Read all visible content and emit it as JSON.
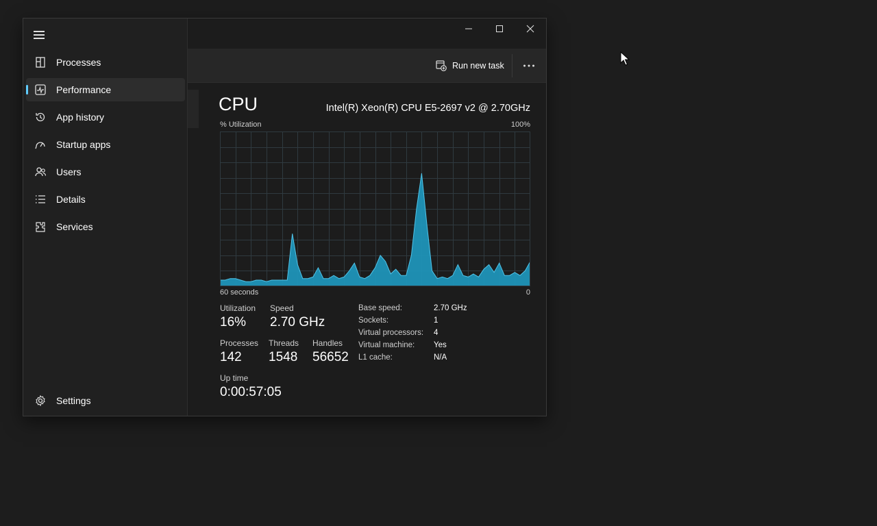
{
  "sidebar": {
    "items": [
      {
        "label": "Processes",
        "icon": "processes-icon"
      },
      {
        "label": "Performance",
        "icon": "performance-icon",
        "active": true
      },
      {
        "label": "App history",
        "icon": "app-history-icon"
      },
      {
        "label": "Startup apps",
        "icon": "startup-apps-icon"
      },
      {
        "label": "Users",
        "icon": "users-icon"
      },
      {
        "label": "Details",
        "icon": "details-icon"
      },
      {
        "label": "Services",
        "icon": "services-icon"
      }
    ],
    "settings_label": "Settings"
  },
  "commandbar": {
    "run_new_task": "Run new task"
  },
  "cpu": {
    "title": "CPU",
    "name": "Intel(R) Xeon(R) CPU E5-2697 v2 @ 2.70GHz",
    "utilization_axis_label": "% Utilization",
    "utilization_axis_max": "100%",
    "time_axis_left": "60 seconds",
    "time_axis_right": "0",
    "stats": {
      "utilization_label": "Utilization",
      "utilization_value": "16%",
      "speed_label": "Speed",
      "speed_value": "2.70 GHz",
      "processes_label": "Processes",
      "processes_value": "142",
      "threads_label": "Threads",
      "threads_value": "1548",
      "handles_label": "Handles",
      "handles_value": "56652",
      "uptime_label": "Up time",
      "uptime_value": "0:00:57:05"
    },
    "info": [
      {
        "label": "Base speed:",
        "value": "2.70 GHz"
      },
      {
        "label": "Sockets:",
        "value": "1"
      },
      {
        "label": "Virtual processors:",
        "value": "4"
      },
      {
        "label": "Virtual machine:",
        "value": "Yes"
      },
      {
        "label": "L1 cache:",
        "value": "N/A"
      }
    ]
  },
  "colors": {
    "accent": "#60cdff",
    "graph_fill": "#1f93b8",
    "graph_line": "#4fc3e8",
    "grid": "#2f3a40"
  },
  "chart_data": {
    "type": "area",
    "title": "",
    "xlabel": "",
    "ylabel": "% Utilization",
    "ylim": [
      0,
      100
    ],
    "xlim": [
      60,
      0
    ],
    "x": [
      60,
      59,
      58,
      57,
      56,
      55,
      54,
      53,
      52,
      51,
      50,
      49,
      48,
      47,
      46,
      45,
      44,
      43,
      42,
      41,
      40,
      39,
      38,
      37,
      36,
      35,
      34,
      33,
      32,
      31,
      30,
      29,
      28,
      27,
      26,
      25,
      24,
      23,
      22,
      21,
      20,
      19,
      18,
      17,
      16,
      15,
      14,
      13,
      12,
      11,
      10,
      9,
      8,
      7,
      6,
      5,
      4,
      3,
      2,
      1,
      0
    ],
    "series": [
      {
        "values": [
          4,
          4,
          5,
          5,
          4,
          3,
          3,
          4,
          4,
          3,
          4,
          4,
          4,
          4,
          34,
          14,
          5,
          5,
          6,
          12,
          5,
          5,
          7,
          5,
          6,
          10,
          15,
          6,
          5,
          7,
          12,
          20,
          16,
          8,
          11,
          7,
          7,
          20,
          50,
          73,
          40,
          10,
          5,
          6,
          5,
          7,
          14,
          7,
          6,
          8,
          6,
          11,
          14,
          9,
          15,
          7,
          7,
          9,
          7,
          10,
          16
        ]
      }
    ],
    "grid": true
  }
}
